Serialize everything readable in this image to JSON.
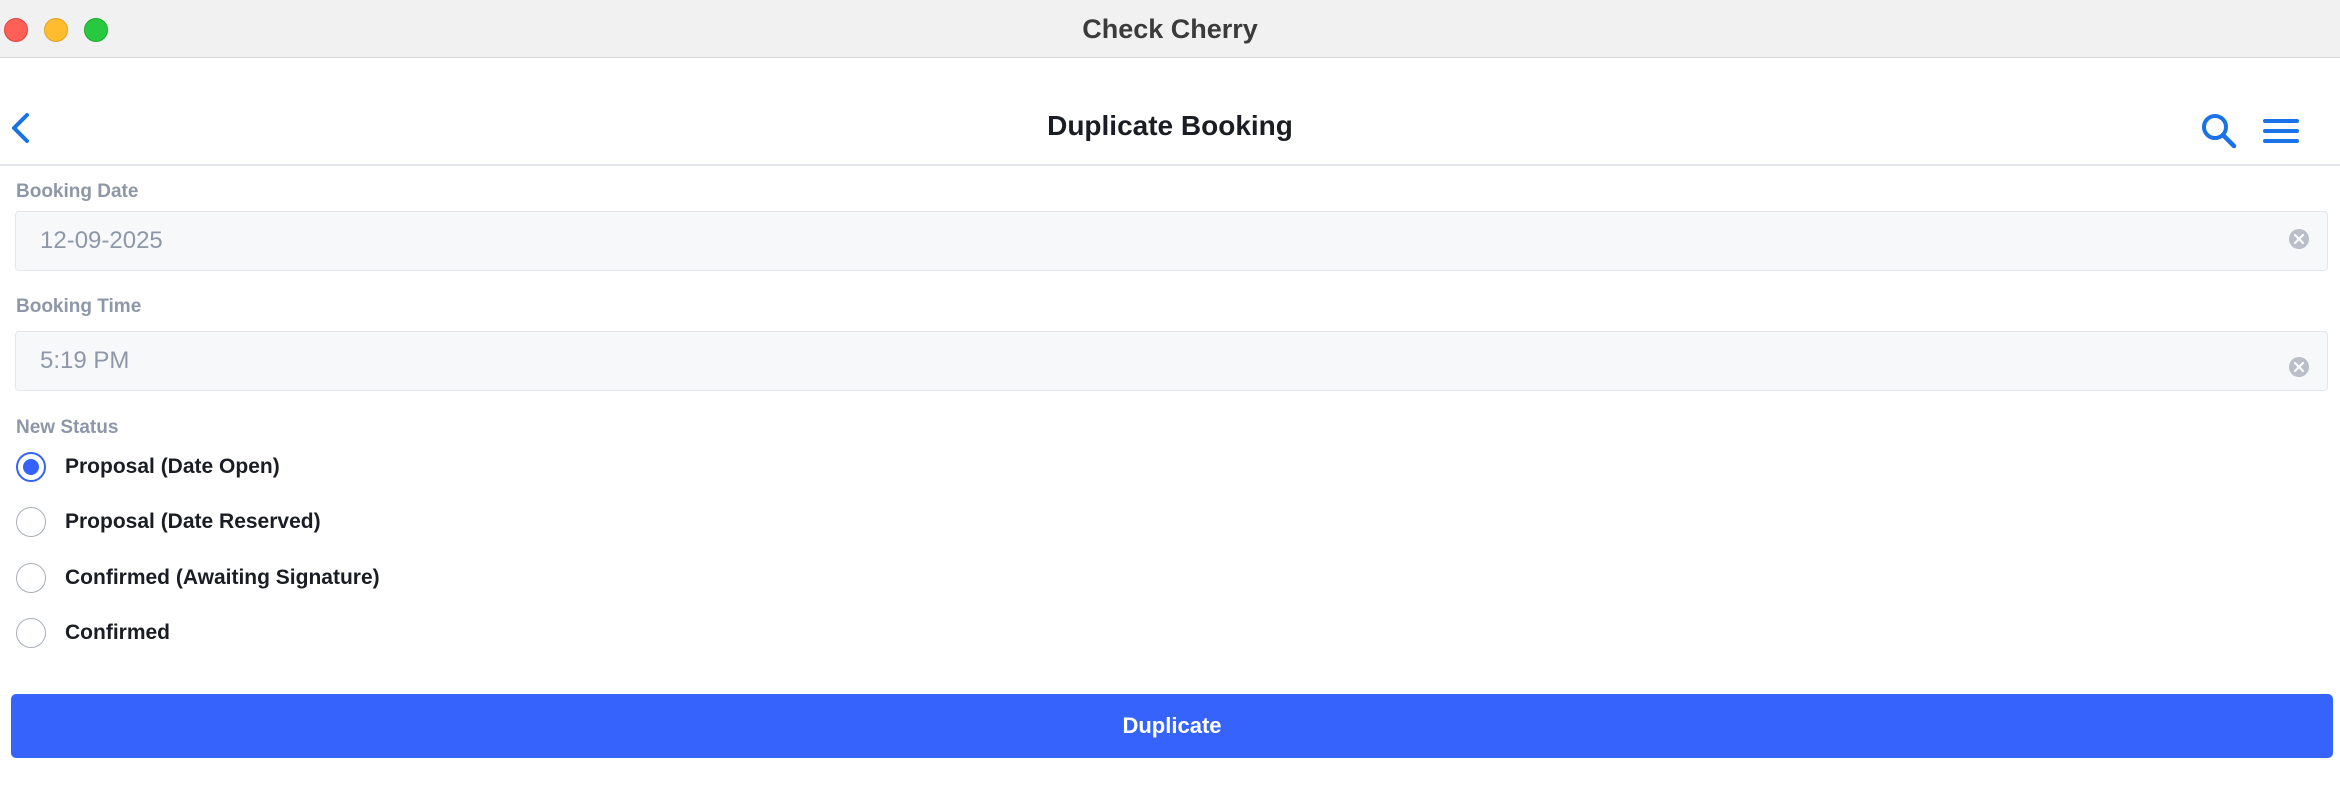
{
  "window": {
    "title": "Check Cherry"
  },
  "navbar": {
    "title": "Duplicate Booking",
    "back_icon": "chevron-left-icon",
    "search_icon": "search-icon",
    "menu_icon": "hamburger-menu-icon"
  },
  "form": {
    "booking_date": {
      "label": "Booking Date",
      "value": "12-09-2025"
    },
    "booking_time": {
      "label": "Booking Time",
      "value": "5:19 PM"
    },
    "status": {
      "label": "New Status",
      "selected_index": 0,
      "options": [
        "Proposal (Date Open)",
        "Proposal (Date Reserved)",
        "Confirmed (Awaiting Signature)",
        "Confirmed"
      ]
    },
    "submit_label": "Duplicate"
  },
  "colors": {
    "accent": "#3563fb",
    "icon_blue": "#1a72e8",
    "label_gray": "#8e97a8"
  }
}
